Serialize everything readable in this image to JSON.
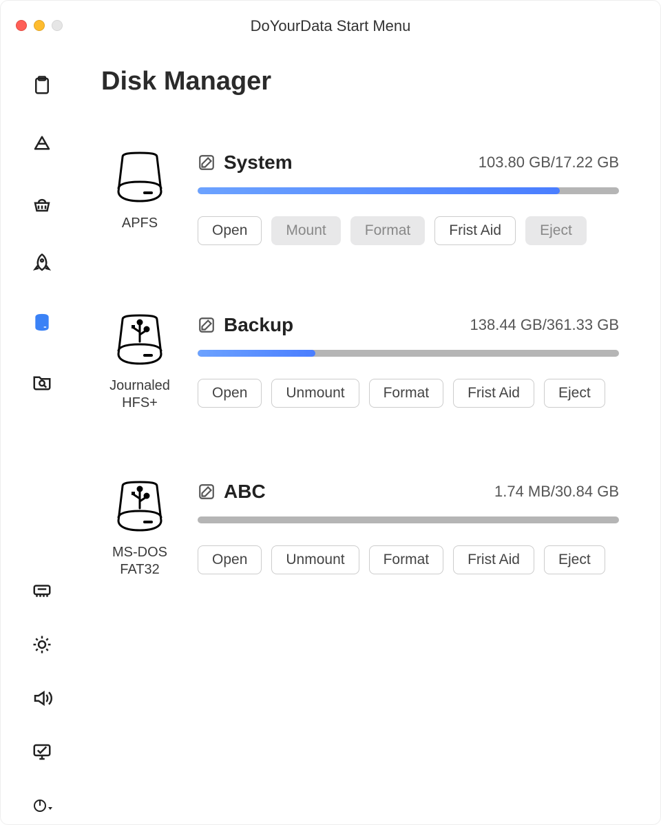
{
  "window": {
    "title": "DoYourData Start Menu"
  },
  "page": {
    "title": "Disk Manager"
  },
  "sidebar": {
    "top": [
      {
        "name": "clipboard",
        "active": false
      },
      {
        "name": "apps",
        "active": false
      },
      {
        "name": "cleaner",
        "active": false
      },
      {
        "name": "rocket",
        "active": false
      },
      {
        "name": "disk",
        "active": true
      },
      {
        "name": "file-search",
        "active": false
      }
    ],
    "bottom": [
      {
        "name": "memory"
      },
      {
        "name": "brightness"
      },
      {
        "name": "sound"
      },
      {
        "name": "display"
      },
      {
        "name": "power"
      }
    ]
  },
  "buttons": {
    "open": "Open",
    "mount": "Mount",
    "unmount": "Unmount",
    "format": "Format",
    "first_aid": "Frist Aid",
    "eject": "Eject"
  },
  "disks": [
    {
      "name": "System",
      "filesystem": "APFS",
      "size_text": "103.80 GB/17.22 GB",
      "used_pct": 86,
      "type": "internal",
      "actions": [
        {
          "key": "open",
          "enabled": true
        },
        {
          "key": "mount",
          "enabled": false
        },
        {
          "key": "format",
          "enabled": false
        },
        {
          "key": "first_aid",
          "enabled": true
        },
        {
          "key": "eject",
          "enabled": false
        }
      ]
    },
    {
      "name": "Backup",
      "filesystem": "Journaled HFS+",
      "size_text": "138.44 GB/361.33 GB",
      "used_pct": 28,
      "type": "external",
      "actions": [
        {
          "key": "open",
          "enabled": true
        },
        {
          "key": "unmount",
          "enabled": true
        },
        {
          "key": "format",
          "enabled": true
        },
        {
          "key": "first_aid",
          "enabled": true
        },
        {
          "key": "eject",
          "enabled": true
        }
      ]
    },
    {
      "name": "ABC",
      "filesystem": "MS-DOS FAT32",
      "size_text": "1.74 MB/30.84 GB",
      "used_pct": 0,
      "type": "external",
      "actions": [
        {
          "key": "open",
          "enabled": true
        },
        {
          "key": "unmount",
          "enabled": true
        },
        {
          "key": "format",
          "enabled": true
        },
        {
          "key": "first_aid",
          "enabled": true
        },
        {
          "key": "eject",
          "enabled": true
        }
      ]
    }
  ]
}
